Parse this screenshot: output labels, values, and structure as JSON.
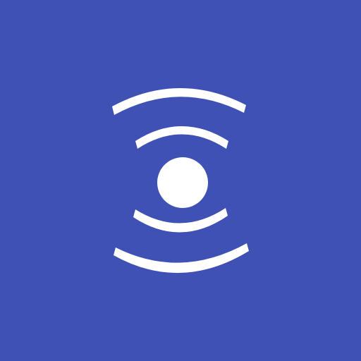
{
  "icon": {
    "name": "signal-broadcast-icon",
    "background_color": "#3f51b5",
    "foreground_color": "#ffffff"
  }
}
